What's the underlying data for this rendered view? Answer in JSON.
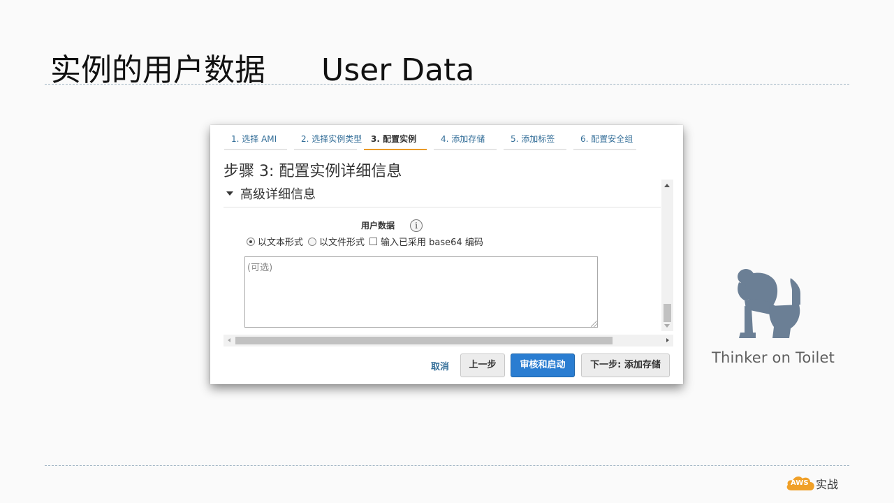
{
  "slide": {
    "title_cn": "实例的用户数据",
    "title_en": "User Data"
  },
  "wizard": {
    "steps": [
      {
        "label": "1. 选择 AMI",
        "active": false
      },
      {
        "label": "2. 选择实例类型",
        "active": false
      },
      {
        "label": "3. 配置实例",
        "active": true
      },
      {
        "label": "4. 添加存储",
        "active": false
      },
      {
        "label": "5. 添加标签",
        "active": false
      },
      {
        "label": "6. 配置安全组",
        "active": false
      }
    ],
    "heading": "步骤 3: 配置实例详细信息",
    "section_title": "高级详细信息",
    "user_data_label": "用户数据",
    "info_icon_glyph": "i",
    "options": {
      "as_text": "以文本形式",
      "as_file": "以文件形式",
      "base64": "输入已采用 base64 编码",
      "selected": "as_text"
    },
    "textarea_placeholder": "(可选)",
    "buttons": {
      "cancel": "取消",
      "previous": "上一步",
      "review_launch": "审核和启动",
      "next": "下一步: 添加存储"
    }
  },
  "branding": {
    "logo_text": "Thinker on Toilet",
    "badge_text": "AWS",
    "badge_label": "实战",
    "accent_color": "#e99a28",
    "primary_button_color": "#2a7dd1",
    "logo_color": "#6b7f95"
  }
}
